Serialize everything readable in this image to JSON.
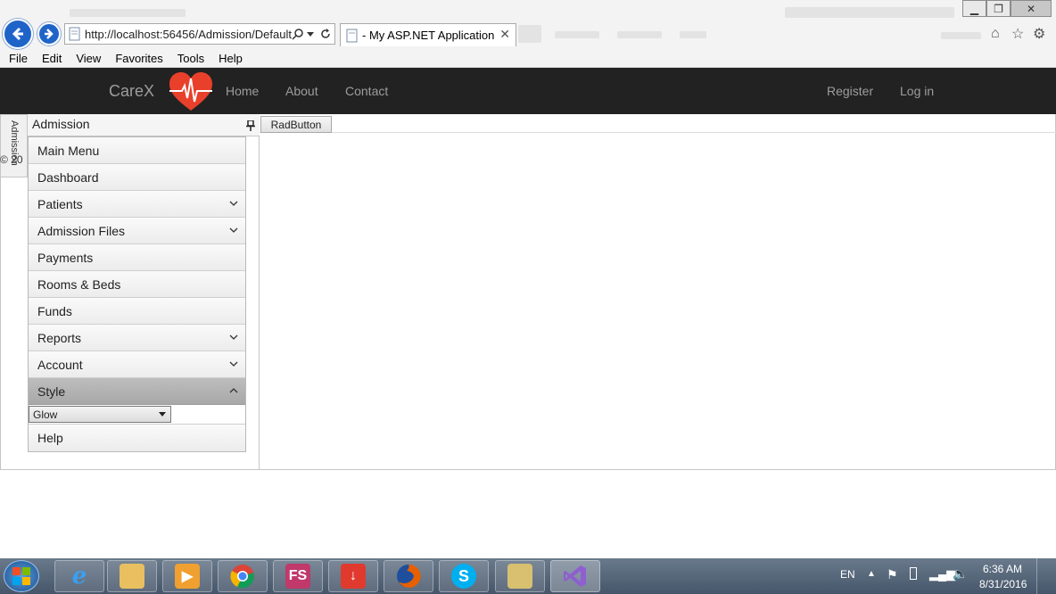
{
  "browser": {
    "address_url": "http://localhost:56456/Admission/Default",
    "tab_title": "- My ASP.NET Application",
    "menu": [
      "File",
      "Edit",
      "View",
      "Favorites",
      "Tools",
      "Help"
    ]
  },
  "site": {
    "brand": "CareX",
    "nav_left": [
      "Home",
      "About",
      "Contact"
    ],
    "nav_right": [
      "Register",
      "Log in"
    ],
    "brand_color": "#e8402b"
  },
  "pane": {
    "vertical_tab": "Admission",
    "title": "Admission",
    "copyright": "© 20",
    "items": [
      {
        "label": "Main Menu",
        "chevron": "none"
      },
      {
        "label": "Dashboard",
        "chevron": "none"
      },
      {
        "label": "Patients",
        "chevron": "down"
      },
      {
        "label": "Admission Files",
        "chevron": "down"
      },
      {
        "label": "Payments",
        "chevron": "none"
      },
      {
        "label": "Rooms & Beds",
        "chevron": "none"
      },
      {
        "label": "Funds",
        "chevron": "none"
      },
      {
        "label": "Reports",
        "chevron": "down"
      },
      {
        "label": "Account",
        "chevron": "down"
      },
      {
        "label": "Style",
        "chevron": "up",
        "selected": true
      }
    ],
    "style_dropdown_value": "Glow",
    "help_label": "Help"
  },
  "content": {
    "rad_button": "RadButton"
  },
  "taskbar": {
    "apps": [
      "ie-icon",
      "file-explorer-icon",
      "media-player-icon",
      "chrome-icon",
      "fs-icon",
      "download-icon",
      "firefox-icon",
      "skype-icon",
      "tool-icon",
      "visual-studio-icon"
    ],
    "fs_label": "FS",
    "skype_label": "S",
    "language": "EN",
    "time": "6:36 AM",
    "date": "8/31/2016"
  }
}
